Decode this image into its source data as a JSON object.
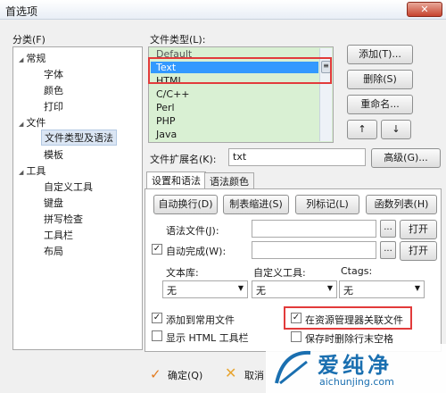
{
  "window": {
    "title": "首选项",
    "close_label": "✕"
  },
  "category": {
    "label": "分类(F)",
    "items": [
      {
        "label": "常规",
        "level": 0,
        "expanded": true
      },
      {
        "label": "字体",
        "level": 1
      },
      {
        "label": "颜色",
        "level": 1
      },
      {
        "label": "打印",
        "level": 1
      },
      {
        "label": "文件",
        "level": 0,
        "expanded": true
      },
      {
        "label": "文件类型及语法",
        "level": 1,
        "selected": true
      },
      {
        "label": "模板",
        "level": 1
      },
      {
        "label": "工具",
        "level": 0,
        "expanded": true
      },
      {
        "label": "自定义工具",
        "level": 1
      },
      {
        "label": "键盘",
        "level": 1
      },
      {
        "label": "拼写检查",
        "level": 1
      },
      {
        "label": "工具栏",
        "level": 1
      },
      {
        "label": "布局",
        "level": 1
      }
    ]
  },
  "file_types": {
    "label": "文件类型(L):",
    "items": [
      "Default",
      "Text",
      "HTML",
      "C/C++",
      "Perl",
      "PHP",
      "Java"
    ],
    "selected": "Text"
  },
  "buttons": {
    "add": "添加(T)...",
    "delete": "删除(S)",
    "rename": "重命名...",
    "up": "↑",
    "down": "↓",
    "advanced": "高级(G)..."
  },
  "extension": {
    "label": "文件扩展名(K):",
    "value": "txt"
  },
  "tabs": [
    "设置和语法",
    "语法颜色"
  ],
  "settings": {
    "auto_wrap": "自动换行(D)",
    "tab_indent": "制表缩进(S)",
    "column_mark": "列标记(L)",
    "function_list": "函数列表(H)",
    "syntax_file_label": "语法文件(J):",
    "syntax_file_value": "",
    "autocomplete_label": "自动完成(W):",
    "autocomplete_value": "",
    "browse": "...",
    "open": "打开",
    "library_label": "文本库:",
    "custom_tool_label": "自定义工具:",
    "ctags_label": "Ctags:",
    "library_value": "无",
    "custom_tool_value": "无",
    "ctags_value": "无",
    "add_to_common": "添加到常用文件",
    "associate_explorer": "在资源管理器关联文件",
    "show_html_toolbar": "显示 HTML 工具栏",
    "trim_on_save": "保存时删除行末空格"
  },
  "footer": {
    "ok": "确定(Q)",
    "cancel": "取消"
  },
  "watermark": {
    "brand": "爱纯净",
    "url": "aichunjing.com"
  }
}
